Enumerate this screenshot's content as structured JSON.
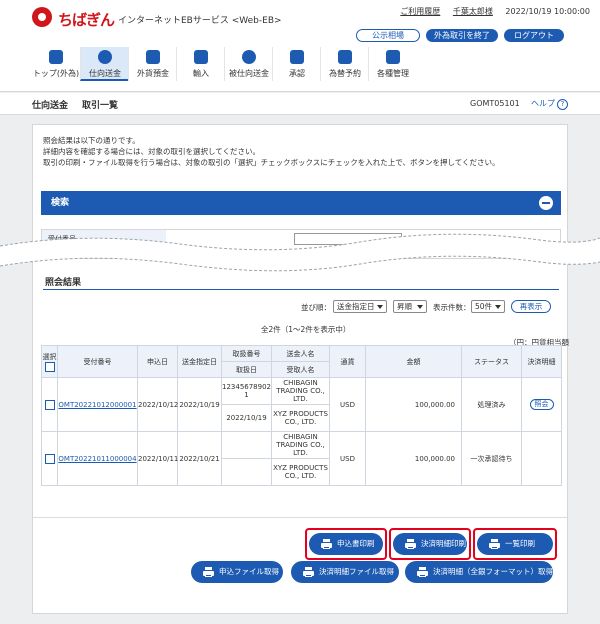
{
  "header": {
    "brand": "ちばぎん",
    "service": "インターネットEBサービス <Web-EB>",
    "usage_history": "ご利用履歴",
    "user_name": "千葉太郎様",
    "datetime": "2022/10/19 10:00:00",
    "public_rates": "公示相場",
    "fx_close": "外為取引を終了",
    "logout": "ログアウト"
  },
  "nav": {
    "items": [
      {
        "label": "トップ(外為)",
        "icon": "house-icon"
      },
      {
        "label": "仕向送金",
        "icon": "remittance-icon"
      },
      {
        "label": "外貨預金",
        "icon": "deposit-icon"
      },
      {
        "label": "輸入",
        "icon": "import-icon"
      },
      {
        "label": "被仕向送金",
        "icon": "incoming-remittance-icon"
      },
      {
        "label": "承認",
        "icon": "approval-icon"
      },
      {
        "label": "為替予約",
        "icon": "fx-reservation-icon"
      },
      {
        "label": "各種管理",
        "icon": "management-icon"
      }
    ],
    "active_index": 1
  },
  "titlebar": {
    "crumb1": "仕向送金",
    "crumb2": "取引一覧",
    "screen_id": "GOMT05101",
    "help": "ヘルプ",
    "help_icon": "?"
  },
  "intro": {
    "line1": "照会結果は以下の通りです。",
    "line2": "詳細内容を確認する場合には、対象の取引を選択してください。",
    "line3": "取引の印刷・ファイル取得を行う場合は、対象の取引の「選択」チェックボックスにチェックを入れた上で、ボタンを押してください。"
  },
  "search": {
    "title": "検索",
    "field_label": "受付番号"
  },
  "results": {
    "title": "照会結果",
    "sort_label": "並び順：",
    "sort_field": "送金指定日",
    "sort_order": "昇順",
    "count_label": "表示件数：",
    "count": "50件",
    "redisplay": "再表示",
    "summary": "全2件（1～2件を表示中）",
    "unit_note": "（円：円貨相当額"
  },
  "table": {
    "headers": {
      "select": "選択",
      "receipt_no": "受付番号",
      "apply_date": "申込日",
      "remit_date": "送金指定日",
      "deal_no": "取扱番号",
      "deal_date": "取扱日",
      "sender": "送金人名",
      "receiver": "受取人名",
      "currency": "通貨",
      "amount": "金額",
      "status": "ステータス",
      "statement": "決済明細"
    },
    "rows": [
      {
        "receipt_no": "OMT20221012000001",
        "apply_date": "2022/10/12",
        "remit_date": "2022/10/19",
        "deal_no": "12345678902 1",
        "deal_date": "2022/10/19",
        "sender": "CHIBAGIN TRADING CO., LTD.",
        "receiver": "XYZ PRODUCTS CO., LTD.",
        "currency": "USD",
        "amount": "100,000.00",
        "status": "処理済み",
        "statement_button": "照会"
      },
      {
        "receipt_no": "OMT20221011000004",
        "apply_date": "2022/10/11",
        "remit_date": "2022/10/21",
        "deal_no": "",
        "deal_date": "",
        "sender": "CHIBAGIN TRADING CO., LTD.",
        "receiver": "XYZ PRODUCTS CO., LTD.",
        "currency": "USD",
        "amount": "100,000.00",
        "status": "一次承認待ち",
        "statement_button": ""
      }
    ]
  },
  "actions": {
    "print_application": "申込書印刷",
    "print_statement": "決済明細印刷",
    "print_list": "一覧印刷",
    "get_application_file": "申込ファイル取得",
    "get_statement_file": "決済明細ファイル取得",
    "get_statement_full": "決済明細（全銀フォーマット）取得"
  },
  "colors": {
    "brand_red": "#d0161b",
    "primary_blue": "#1d5bb3",
    "highlight_red": "#e5001c"
  }
}
